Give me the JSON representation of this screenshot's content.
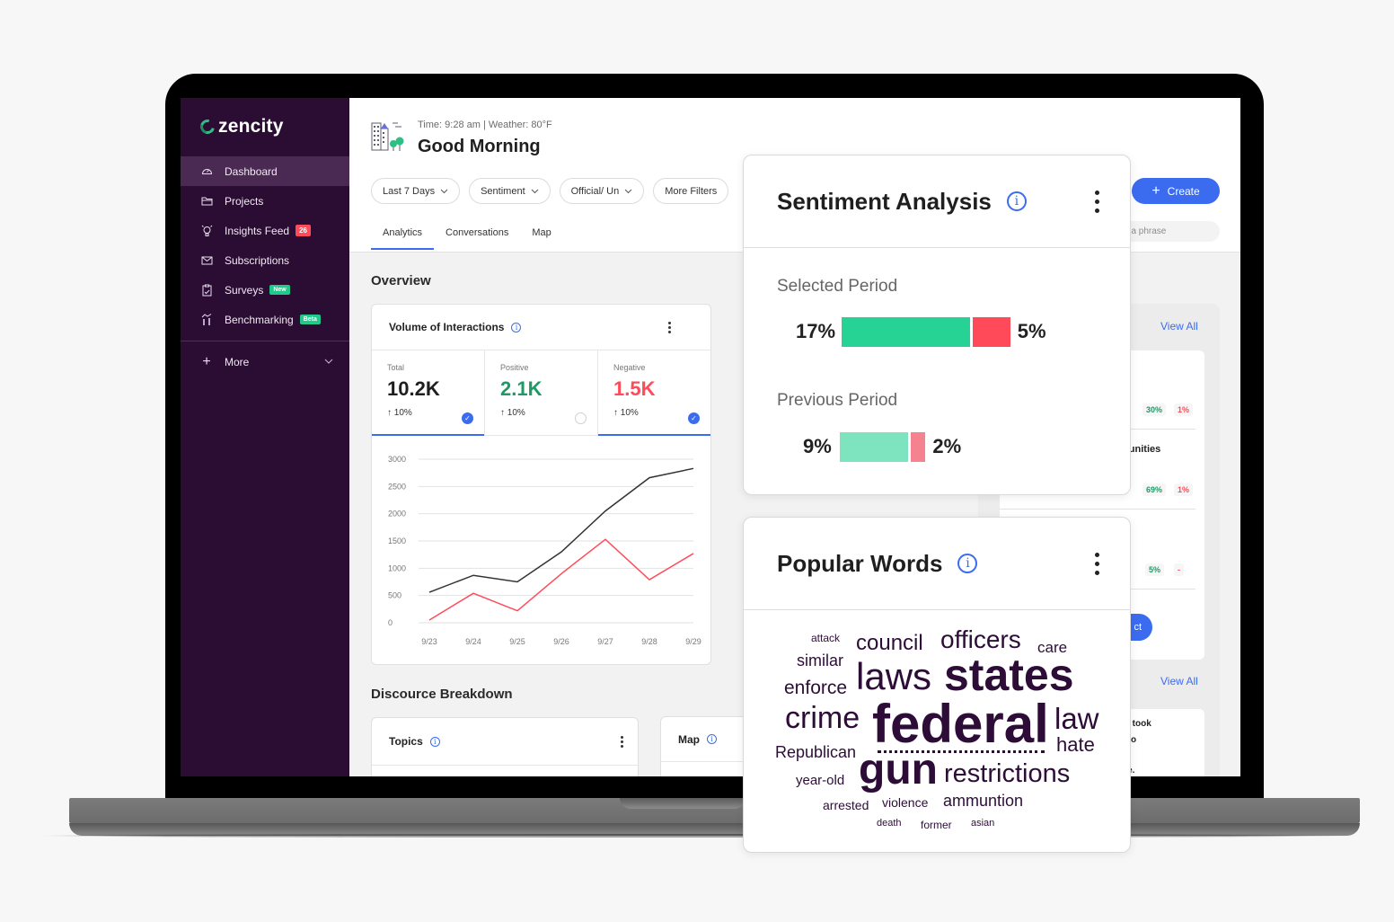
{
  "sidebar": {
    "brand": "zencity",
    "items": [
      {
        "label": "Dashboard",
        "icon": "gauge-icon",
        "active": true
      },
      {
        "label": "Projects",
        "icon": "folder-icon"
      },
      {
        "label": "Insights Feed",
        "icon": "lightbulb-icon",
        "badge": "26"
      },
      {
        "label": "Subscriptions",
        "icon": "envelope-icon"
      },
      {
        "label": "Surveys",
        "icon": "clipboard-icon",
        "badge": "New"
      },
      {
        "label": "Benchmarking",
        "icon": "benchmark-icon",
        "badge": "Beta"
      }
    ],
    "more_label": "More"
  },
  "header": {
    "time_weather": "Time: 9:28 am | Weather: 80°F",
    "greeting": "Good Morning",
    "filters": [
      "Last 7 Days",
      "Sentiment",
      "Official/ Un",
      "More Filters"
    ],
    "create_label": "Create",
    "search_placeholder": "for a phrase",
    "tabs": [
      {
        "label": "Analytics",
        "active": true
      },
      {
        "label": "Conversations"
      },
      {
        "label": "Map"
      }
    ]
  },
  "overview": {
    "title": "Overview",
    "volume_card": {
      "title": "Volume of Interactions",
      "kpis": [
        {
          "label": "Total",
          "value": "10.2K",
          "change": "↑ 10%",
          "checked": true,
          "color": "#1f1f1f"
        },
        {
          "label": "Positive",
          "value": "2.1K",
          "change": "↑ 10%",
          "checked": false,
          "color": "#1f9a66"
        },
        {
          "label": "Negative",
          "value": "1.5K",
          "change": "↑ 10%",
          "checked": true,
          "color": "#ff4a5a"
        }
      ]
    }
  },
  "chart_data": {
    "type": "line",
    "title": "",
    "xlabel": "",
    "ylabel": "",
    "x": [
      "9/23",
      "9/24",
      "9/25",
      "9/26",
      "9/27",
      "9/28",
      "9/29"
    ],
    "yticks": [
      0,
      500,
      1000,
      1500,
      2000,
      2500,
      3000
    ],
    "ylim": [
      0,
      3000
    ],
    "grid": true,
    "series": [
      {
        "name": "Total",
        "color": "#333333",
        "values": [
          560,
          870,
          750,
          1300,
          2050,
          2660,
          2830
        ]
      },
      {
        "name": "Negative",
        "color": "#ff4a5a",
        "values": [
          50,
          540,
          220,
          900,
          1530,
          790,
          1270
        ]
      }
    ]
  },
  "discourse": {
    "title": "Discource Breakdown",
    "topics_title": "Topics",
    "map_title": "Map"
  },
  "right_panel": {
    "view_all_1": "View All",
    "view_all_2": "View All",
    "rows": [
      {
        "text": "",
        "positive": "30%",
        "negative": "1%"
      },
      {
        "text": "munities",
        "positive": "69%",
        "negative": "1%"
      },
      {
        "text": "",
        "positive": "5%",
        "negative": "-"
      }
    ],
    "connect_label": "ct",
    "news_lines": [
      "ts took",
      "r to",
      "e",
      "ge."
    ]
  },
  "sentiment_card": {
    "title": "Sentiment Analysis",
    "selected": {
      "label": "Selected Period",
      "positive_pct": "17%",
      "negative_pct": "5%",
      "positive": 17,
      "negative": 5
    },
    "previous": {
      "label": "Previous Period",
      "positive_pct": "9%",
      "negative_pct": "2%",
      "positive": 9,
      "negative": 2
    },
    "colors": {
      "positive": "#26d294",
      "negative": "#ff4a5a",
      "positive_prev": "#7ee3bf",
      "negative_prev": "#f4838f"
    }
  },
  "words_card": {
    "title": "Popular Words",
    "words": [
      "attack",
      "council",
      "officers",
      "care",
      "similar",
      "laws",
      "states",
      "enforce",
      "crime",
      "federal",
      "law",
      "hate",
      "Republican",
      "gun",
      "restrictions",
      "year-old",
      "arrested",
      "violence",
      "ammuntion",
      "death",
      "former",
      "asian"
    ]
  }
}
